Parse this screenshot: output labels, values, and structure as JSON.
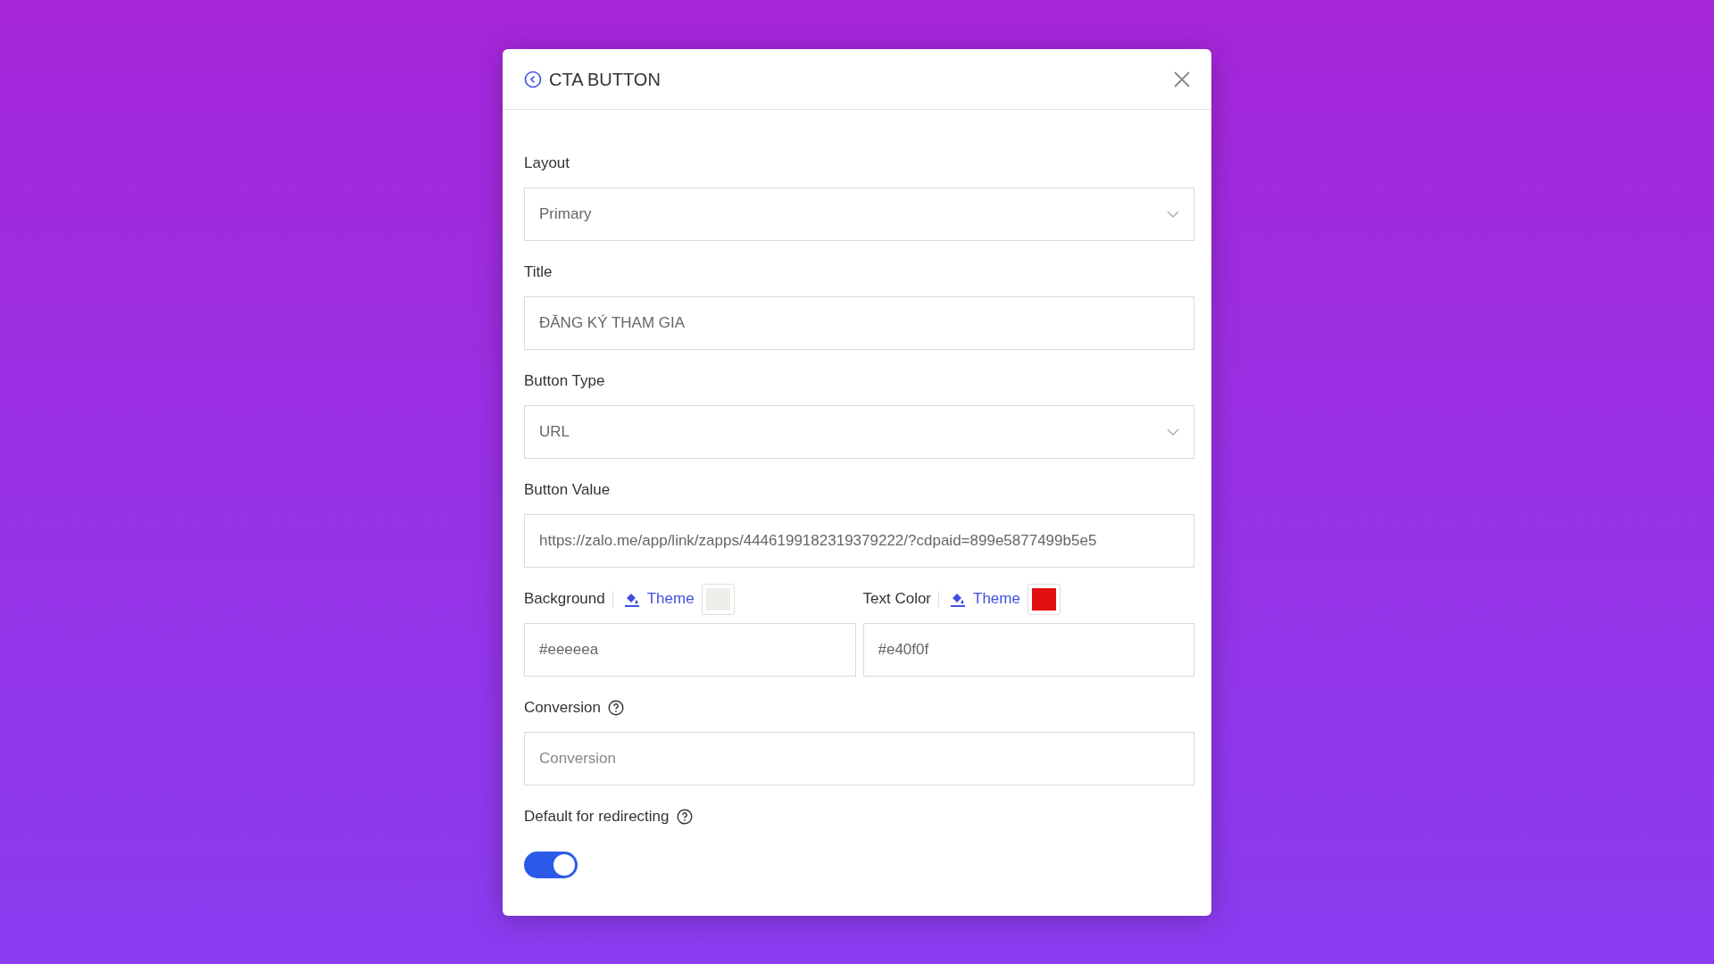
{
  "dialog": {
    "title": "CTA BUTTON"
  },
  "fields": [
    {
      "kind": "select",
      "label": "Layout",
      "value": "Primary"
    },
    {
      "kind": "text",
      "label": "Title",
      "value": "ĐĂNG KÝ THAM GIA"
    },
    {
      "kind": "select",
      "label": "Button Type",
      "value": "URL"
    },
    {
      "kind": "text",
      "label": "Button Value",
      "value": "https://zalo.me/app/link/zapps/4446199182319379222/?cdpaid=899e5877499b5e5"
    },
    {
      "kind": "colors",
      "items": [
        {
          "label": "Background",
          "theme": "Theme",
          "color": "#eeeeea",
          "value": "#eeeeea"
        },
        {
          "label": "Text Color",
          "theme": "Theme",
          "color": "#e40f0f",
          "value": "#e40f0f"
        }
      ]
    },
    {
      "kind": "text",
      "label": "Conversion",
      "help": true,
      "placeholder": "Conversion"
    },
    {
      "kind": "toggle",
      "label": "Default for redirecting",
      "help": true,
      "on": true
    }
  ]
}
